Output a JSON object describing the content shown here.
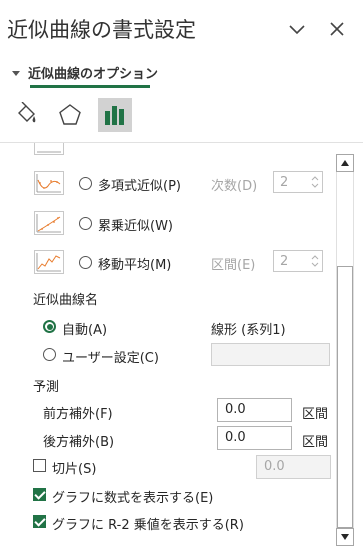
{
  "pane": {
    "title": "近似曲線の書式設定",
    "section_label": "近似曲線のオプション"
  },
  "trend_types": [
    {
      "label": "多項式近似(P)",
      "param_label": "次数(D)",
      "param_value": "2",
      "disabled_param": true
    },
    {
      "label": "累乗近似(W)"
    },
    {
      "label": "移動平均(M)",
      "param_label": "区間(E)",
      "param_value": "2",
      "disabled_param": true
    }
  ],
  "trendline_name": {
    "group_label": "近似曲線名",
    "auto_label": "自動(A)",
    "auto_value": "線形 (系列1)",
    "custom_label": "ユーザー設定(C)",
    "custom_value": ""
  },
  "forecast": {
    "group_label": "予測",
    "forward_label": "前方補外(F)",
    "forward_value": "0.0",
    "forward_unit": "区間",
    "backward_label": "後方補外(B)",
    "backward_value": "0.0",
    "backward_unit": "区間"
  },
  "intercept": {
    "label": "切片(S)",
    "value": "0.0",
    "checked": false
  },
  "display_equation": {
    "label": "グラフに数式を表示する(E)",
    "checked": true
  },
  "display_r2": {
    "label": "グラフに R-2 乗値を表示する(R)",
    "checked": true
  },
  "colors": {
    "accent": "#217346",
    "disabled": "#a6a6a6"
  }
}
